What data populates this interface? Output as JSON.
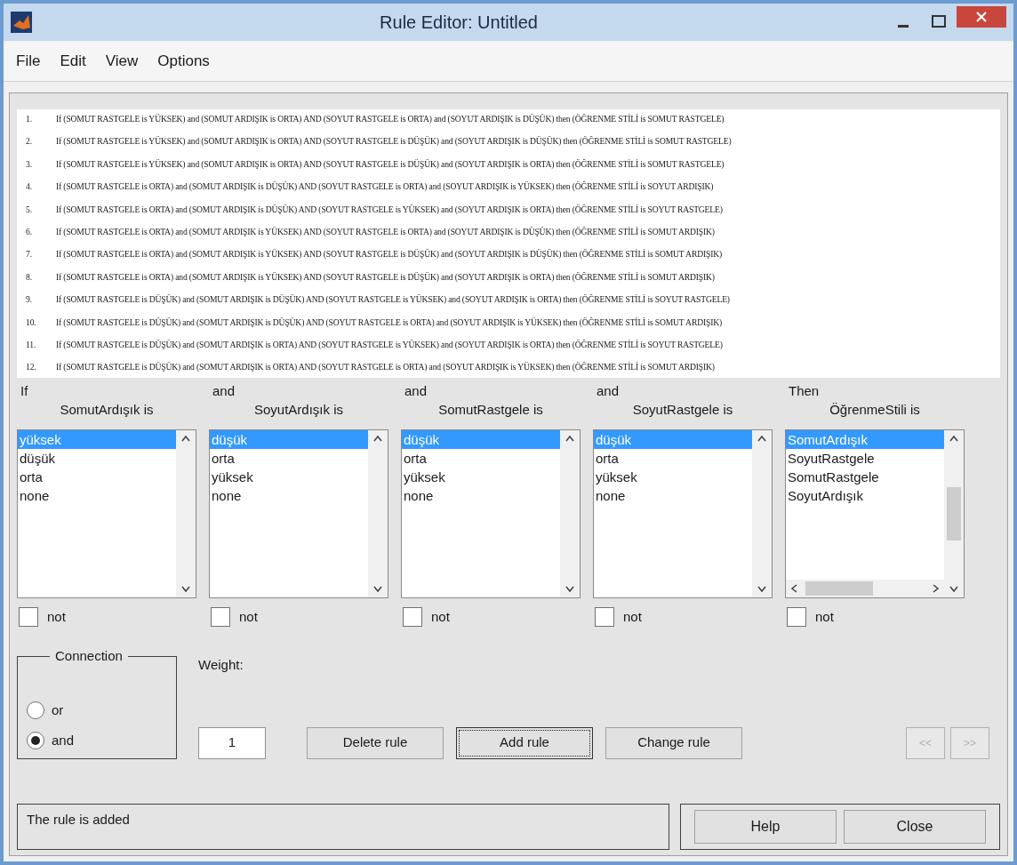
{
  "window": {
    "title": "Rule Editor: Untitled"
  },
  "menu": [
    "File",
    "Edit",
    "View",
    "Options"
  ],
  "rules": [
    {
      "number": "1.",
      "text": "If (SOMUT RASTGELE is YÜKSEK) and (SOMUT ARDIŞIK is ORTA) AND (SOYUT RASTGELE is ORTA) and (SOYUT ARDIŞIK is DÜŞÜK) then (ÖĞRENME STİLİ is SOMUT RASTGELE)"
    },
    {
      "number": "2.",
      "text": "If (SOMUT RASTGELE is YÜKSEK) and (SOMUT ARDIŞIK is ORTA) AND (SOYUT RASTGELE is DÜŞÜK) and (SOYUT ARDIŞIK is DÜŞÜK) then (ÖĞRENME STİLİ is SOMUT RASTGELE)"
    },
    {
      "number": "3.",
      "text": "If (SOMUT RASTGELE is YÜKSEK) and (SOMUT ARDIŞIK is ORTA) AND (SOYUT RASTGELE is DÜŞÜK) and (SOYUT ARDIŞIK is ORTA) then (ÖĞRENME STİLİ is SOMUT RASTGELE)"
    },
    {
      "number": "4.",
      "text": "If (SOMUT RASTGELE is ORTA) and (SOMUT ARDIŞIK is DÜŞÜK) AND (SOYUT RASTGELE is ORTA) and (SOYUT ARDIŞIK is YÜKSEK) then (ÖĞRENME STİLİ is SOYUT ARDIŞIK)"
    },
    {
      "number": "5.",
      "text": "If (SOMUT RASTGELE is ORTA) and (SOMUT ARDIŞIK is DÜŞÜK) AND (SOYUT RASTGELE is YÜKSEK) and (SOYUT ARDIŞIK is ORTA) then (ÖĞRENME STİLİ is SOYUT RASTGELE)"
    },
    {
      "number": "6.",
      "text": "If (SOMUT RASTGELE is ORTA) and (SOMUT ARDIŞIK is YÜKSEK) AND (SOYUT RASTGELE is ORTA) and (SOYUT ARDIŞIK is DÜŞÜK) then (ÖĞRENME STİLİ is SOMUT ARDIŞIK)"
    },
    {
      "number": "7.",
      "text": "If (SOMUT RASTGELE is ORTA) and (SOMUT ARDIŞIK is YÜKSEK) AND (SOYUT RASTGELE is DÜŞÜK) and (SOYUT ARDIŞIK is DÜŞÜK) then (ÖĞRENME STİLİ is SOMUT ARDIŞIK)"
    },
    {
      "number": "8.",
      "text": "If (SOMUT RASTGELE is ORTA) and (SOMUT ARDIŞIK is YÜKSEK) AND (SOYUT RASTGELE is DÜŞÜK) and (SOYUT ARDIŞIK is ORTA) then (ÖĞRENME STİLİ is SOMUT ARDIŞIK)"
    },
    {
      "number": "9.",
      "text": "If (SOMUT RASTGELE is DÜŞÜK) and (SOMUT ARDIŞIK is DÜŞÜK) AND (SOYUT RASTGELE is YÜKSEK) and (SOYUT ARDIŞIK is ORTA) then (ÖĞRENME STİLİ is SOYUT RASTGELE)"
    },
    {
      "number": "10.",
      "text": "If (SOMUT RASTGELE is DÜŞÜK) and (SOMUT ARDIŞIK is DÜŞÜK) AND (SOYUT RASTGELE is ORTA) and (SOYUT ARDIŞIK is YÜKSEK) then (ÖĞRENME STİLİ is SOMUT ARDIŞIK)"
    },
    {
      "number": "11.",
      "text": "If (SOMUT RASTGELE is DÜŞÜK) and (SOMUT ARDIŞIK is ORTA) AND (SOYUT RASTGELE is YÜKSEK) and (SOYUT ARDIŞIK is ORTA) then (ÖĞRENME STİLİ is SOYUT RASTGELE)"
    },
    {
      "number": "12.",
      "text": "If (SOMUT RASTGELE is DÜŞÜK) and (SOMUT ARDIŞIK is ORTA) AND (SOYUT RASTGELE is ORTA) and (SOYUT ARDIŞIK is YÜKSEK) then (ÖĞRENME STİLİ is SOMUT ARDIŞIK)"
    }
  ],
  "variables": [
    {
      "connector": "If",
      "label": "SomutArdışık is",
      "items": [
        {
          "text": "yüksek",
          "selected": true
        },
        {
          "text": "düşük",
          "selected": false
        },
        {
          "text": "orta",
          "selected": false
        },
        {
          "text": "none",
          "selected": false
        }
      ],
      "hscroll": false,
      "not_label": "not",
      "not_checked": false
    },
    {
      "connector": "and",
      "label": "SoyutArdışık is",
      "items": [
        {
          "text": "düşük",
          "selected": true
        },
        {
          "text": "orta",
          "selected": false
        },
        {
          "text": "yüksek",
          "selected": false
        },
        {
          "text": "none",
          "selected": false
        }
      ],
      "hscroll": false,
      "not_label": "not",
      "not_checked": false
    },
    {
      "connector": "and",
      "label": "SomutRastgele is",
      "items": [
        {
          "text": "düşük",
          "selected": true
        },
        {
          "text": "orta",
          "selected": false
        },
        {
          "text": "yüksek",
          "selected": false
        },
        {
          "text": "none",
          "selected": false
        }
      ],
      "hscroll": false,
      "not_label": "not",
      "not_checked": false
    },
    {
      "connector": "and",
      "label": "SoyutRastgele is",
      "items": [
        {
          "text": "düşük",
          "selected": true
        },
        {
          "text": "orta",
          "selected": false
        },
        {
          "text": "yüksek",
          "selected": false
        },
        {
          "text": "none",
          "selected": false
        }
      ],
      "hscroll": false,
      "not_label": "not",
      "not_checked": false
    },
    {
      "connector": "Then",
      "label": "ÖğrenmeStili is",
      "items": [
        {
          "text": "SomutArdışık",
          "selected": true
        },
        {
          "text": "SoyutRastgele",
          "selected": false
        },
        {
          "text": "SomutRastgele",
          "selected": false
        },
        {
          "text": "SoyutArdışık",
          "selected": false
        }
      ],
      "hscroll": true,
      "not_label": "not",
      "not_checked": false
    }
  ],
  "connection": {
    "title": "Connection",
    "options": [
      {
        "label": "or",
        "selected": false
      },
      {
        "label": "and",
        "selected": true
      }
    ]
  },
  "weight": {
    "label": "Weight:",
    "value": "1"
  },
  "buttons": [
    {
      "label": "Delete rule",
      "focused": false
    },
    {
      "label": "Add rule",
      "focused": true
    },
    {
      "label": "Change rule",
      "focused": false
    }
  ],
  "nav_buttons": [
    {
      "label": "<<",
      "disabled": true
    },
    {
      "label": ">>",
      "disabled": true
    }
  ],
  "status": "The rule is added",
  "footer_buttons": [
    "Help",
    "Close"
  ]
}
